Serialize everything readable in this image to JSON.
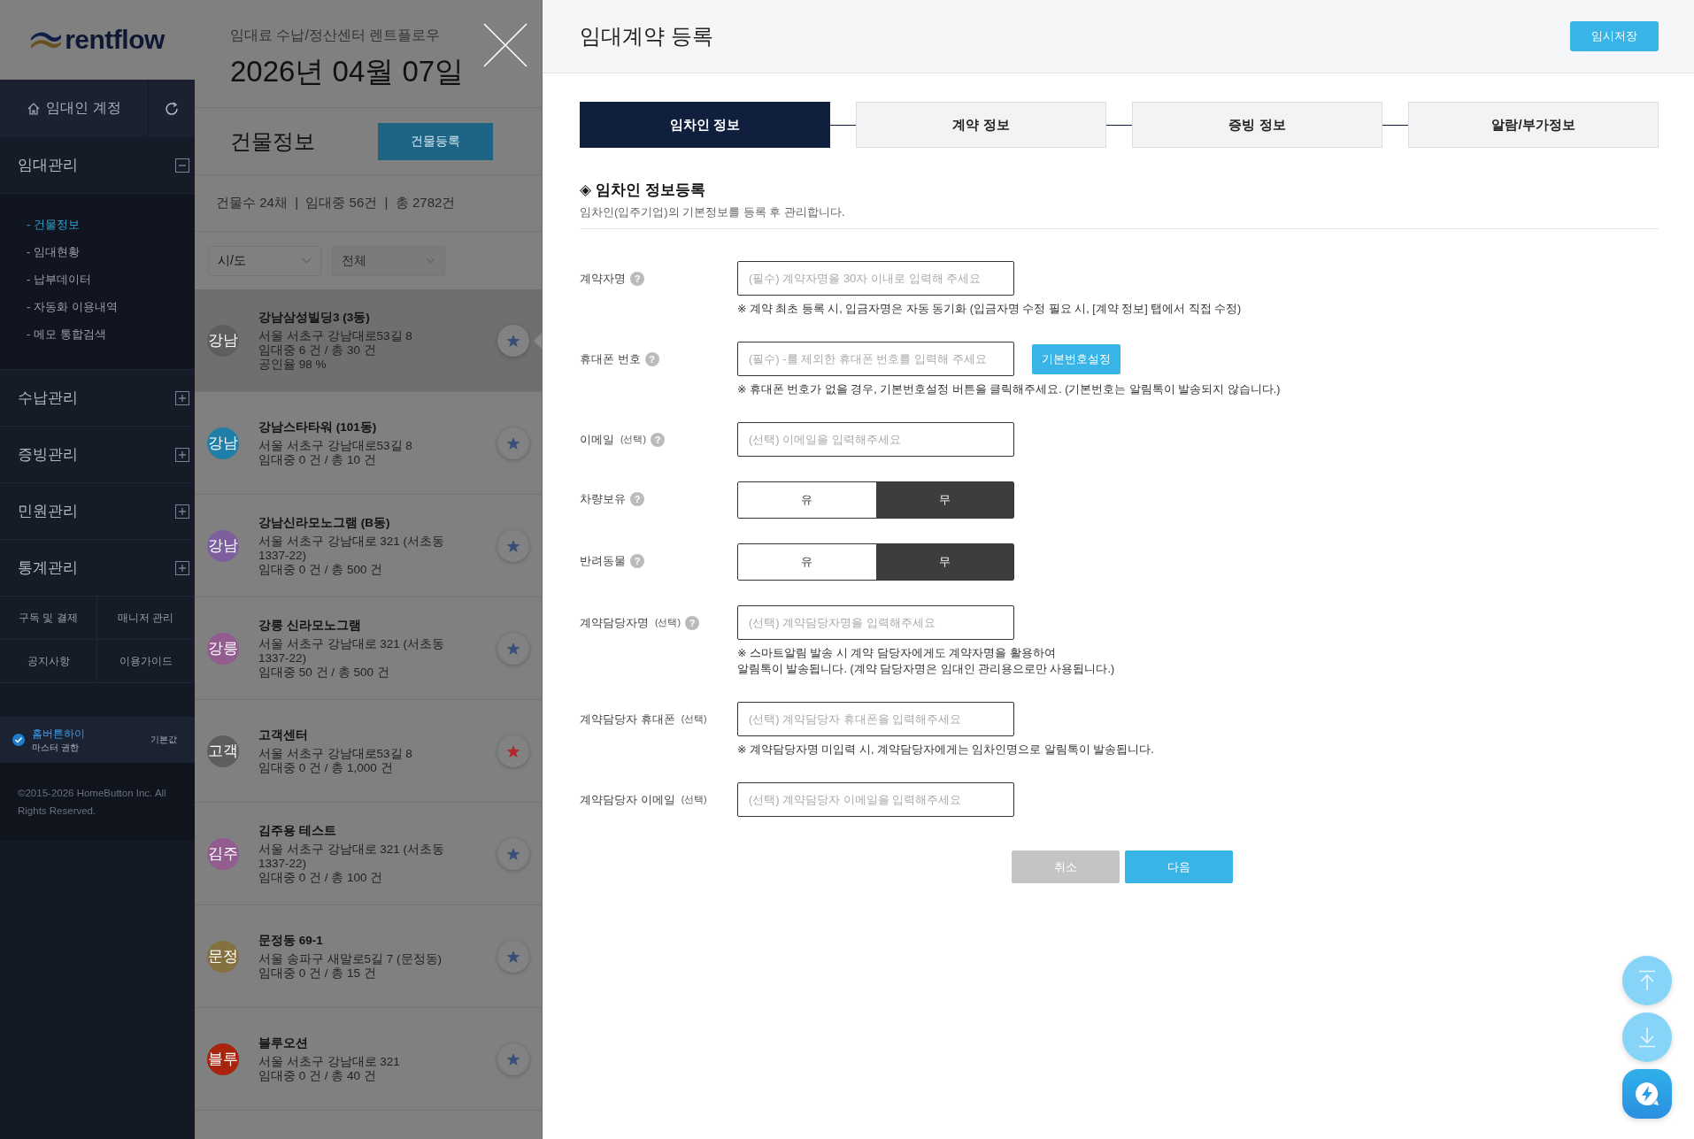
{
  "sidebar": {
    "logo": "rentflow",
    "account": "임대인 계정",
    "sections": [
      {
        "label": "임대관리",
        "expanded": true,
        "children": [
          {
            "label": "- 건물정보",
            "selected": true
          },
          {
            "label": "- 임대현황",
            "selected": false
          },
          {
            "label": "- 납부데이터",
            "selected": false
          },
          {
            "label": "- 자동화 이용내역",
            "selected": false
          },
          {
            "label": "- 메모 통합검색",
            "selected": false
          }
        ]
      },
      {
        "label": "수납관리",
        "expanded": false
      },
      {
        "label": "증빙관리",
        "expanded": false
      },
      {
        "label": "민원관리",
        "expanded": false
      },
      {
        "label": "통계관리",
        "expanded": false
      }
    ],
    "quick_links": [
      "구독 및 결제",
      "매니저 관리",
      "공지사항",
      "이용가이드"
    ],
    "user": {
      "name": "홈버튼하이",
      "role": "마스터 권한",
      "badge": "기본값",
      "checked": true
    },
    "copyright": "©2015-2026 HomeButton Inc. All Rights Reserved."
  },
  "building_panel": {
    "subtitle": "임대료 수납/정산센터 렌트플로우",
    "date": "2026년 04월 07일",
    "title": "건물정보",
    "register_button": "건물등록",
    "stats": "건물수 24채  |  임대중 56건  |  총 2782건",
    "filters": [
      {
        "value": "시/도"
      },
      {
        "value": "전체"
      }
    ],
    "buildings": [
      {
        "avatar": "강남",
        "color": "#5e5e5e",
        "name": "강남삼성빌딩3 (3동)",
        "lines": [
          "서울 서초구 강남대로53길 8",
          "임대중 6 건 / 총 30 건",
          "공인율 98 %"
        ],
        "favorite": false,
        "selected": true
      },
      {
        "avatar": "강남",
        "color": "#1f7fa8",
        "name": "강남스타타워 (101동)",
        "lines": [
          "서울 서초구 강남대로53길 8",
          "임대중 0 건 / 총 10 건"
        ],
        "favorite": false,
        "selected": false
      },
      {
        "avatar": "강남",
        "color": "#7e5f9e",
        "name": "강남신라모노그램 (B동)",
        "lines": [
          "서울 서초구 강남대로 321 (서초동 1337-22)",
          "임대중 0 건 / 총 500 건"
        ],
        "favorite": false,
        "selected": false
      },
      {
        "avatar": "강릉",
        "color": "#935c8f",
        "name": "강릉 신라모노그램",
        "lines": [
          "서울 서초구 강남대로 321 (서초동 1337-22)",
          "임대중 50 건 / 총 500 건"
        ],
        "favorite": false,
        "selected": false
      },
      {
        "avatar": "고객",
        "color": "#5e5e5e",
        "name": "고객센터",
        "lines": [
          "서울 서초구 강남대로53길 8",
          "임대중 0 건 / 총 1,000 건"
        ],
        "favorite": true,
        "selected": false
      },
      {
        "avatar": "김주",
        "color": "#935c8f",
        "name": "김주용 테스트",
        "lines": [
          "서울 서초구 강남대로 321 (서초동 1337-22)",
          "임대중 0 건 / 총 100 건"
        ],
        "favorite": false,
        "selected": false
      },
      {
        "avatar": "문정",
        "color": "#857040",
        "name": "문정동 69-1",
        "lines": [
          "서울 송파구 새말로5길 7 (문정동)",
          "임대중 0 건 / 총 15 건"
        ],
        "favorite": false,
        "selected": false
      },
      {
        "avatar": "블루",
        "color": "#a8240c",
        "name": "블루오션",
        "lines": [
          "서울 서초구 강남대로 321",
          "임대중 0 건 / 총 40 건"
        ],
        "favorite": false,
        "selected": false
      }
    ]
  },
  "modal": {
    "title": "임대계약 등록",
    "save_button": "임시저장",
    "steps": [
      {
        "label": "임차인 정보",
        "selected": true
      },
      {
        "label": "계약 정보",
        "selected": false
      },
      {
        "label": "증빙 정보",
        "selected": false
      },
      {
        "label": "알람/부가정보",
        "selected": false
      }
    ],
    "section_title": "◈ 임차인 정보등록",
    "section_desc": "임차인(입주기업)의 기본정보를 등록 후 관리합니다.",
    "fields": [
      {
        "kind": "text",
        "label": "계약자명",
        "help": "?",
        "placeholder": "(필수) 계약자명을 30자 이내로 입력해 주세요",
        "note": "※ 계약 최초 등록 시, 입금자명은 자동 동기화 (입금자명 수정 필요 시, [계약 정보] 탭에서 직접 수정)"
      },
      {
        "kind": "text",
        "label": "휴대폰 번호",
        "help": "?",
        "placeholder": "(필수) -를 제외한 휴대폰 번호를 입력해 주세요",
        "side_button": "기본번호설정",
        "note": "※ 휴대폰 번호가 없을 경우, 기본번호설정 버튼을 클릭해주세요. (기본번호는 알림톡이 발송되지 않습니다.)"
      },
      {
        "kind": "text",
        "label": "이메일",
        "optional": "(선택)",
        "help": "?",
        "placeholder": "(선택) 이메일을 입력해주세요"
      },
      {
        "kind": "toggle",
        "label": "차량보유",
        "help": "?",
        "options": [
          {
            "label": "유",
            "selected": false
          },
          {
            "label": "무",
            "selected": true
          }
        ]
      },
      {
        "kind": "toggle",
        "label": "반려동물",
        "help": "?",
        "options": [
          {
            "label": "유",
            "selected": false
          },
          {
            "label": "무",
            "selected": true
          }
        ]
      },
      {
        "kind": "text",
        "label": "계약담당자명",
        "optional": "(선택)",
        "help": "?",
        "placeholder": "(선택) 계약담당자명을 입력해주세요",
        "note": "※ 스마트알림 발송 시 계약 담당자에게도 계약자명을 활용하여\n알림톡이 발송됩니다. (계약 담당자명은 임대인 관리용으로만 사용됩니다.)"
      },
      {
        "kind": "text",
        "label": "계약담당자 휴대폰",
        "optional": "(선택)",
        "placeholder": "(선택) 계약담당자 휴대폰을 입력해주세요",
        "note": "※ 계약담당자명 미입력 시, 계약담당자에게는 임차인명으로 알림톡이 발송됩니다."
      },
      {
        "kind": "text",
        "label": "계약담당자 이메일",
        "optional": "(선택)",
        "placeholder": "(선택) 계약담당자 이메일을 입력해주세요"
      }
    ],
    "buttons": [
      {
        "kind": "cancel",
        "label": "취소"
      },
      {
        "kind": "next",
        "label": "다음"
      }
    ]
  }
}
